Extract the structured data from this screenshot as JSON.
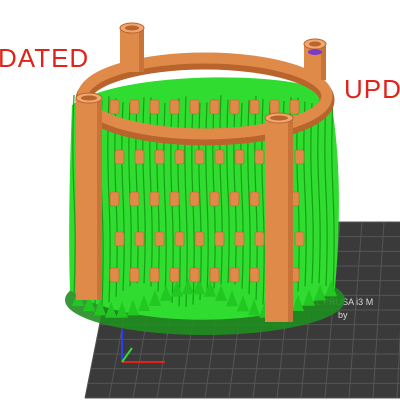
{
  "viewport": {
    "background_color": "#ffffff",
    "bed_color": "#3a3a3a",
    "bed_grid_color": "#555555",
    "support_color": "#2fdc2f",
    "model_color": "#e08a4a",
    "model_shadow_color": "#b8642c"
  },
  "overlay": {
    "left_label": "DATED",
    "right_label": "UPD",
    "label_color": "#e0241b"
  },
  "bed": {
    "brand_text": "L PRUSA i3 M",
    "brand_subtext": "by",
    "axes": {
      "x_axis_color": "#e0241b",
      "y_axis_color": "#2fdc2f",
      "z_axis_color": "#2a3cff"
    }
  }
}
